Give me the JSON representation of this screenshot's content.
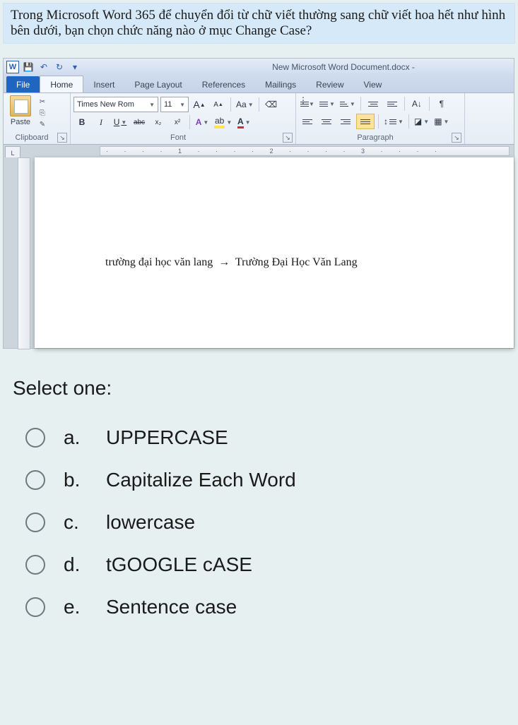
{
  "question": {
    "text": "Trong Microsoft Word 365 để chuyển đổi từ chữ viết thường sang chữ viết hoa hết như hình bên dưới, bạn chọn chức năng nào ở mục Change Case?"
  },
  "word_app": {
    "title": "New Microsoft Word Document.docx -",
    "qat": {
      "w": "W",
      "save": "💾",
      "undo": "↶",
      "redo": "↻",
      "more": "▾"
    },
    "tabs": {
      "file": "File",
      "home": "Home",
      "insert": "Insert",
      "page_layout": "Page Layout",
      "references": "References",
      "mailings": "Mailings",
      "review": "Review",
      "view": "View"
    },
    "clipboard": {
      "paste": "Paste",
      "label": "Clipboard",
      "cut": "✂",
      "copy": "⎘",
      "brush": "✎"
    },
    "font": {
      "name": "Times New Rom",
      "size": "11",
      "grow": "A",
      "shrink": "A",
      "changecase": "Aa",
      "clear": "⌫",
      "bold": "B",
      "italic": "I",
      "underline": "U",
      "strike": "abc",
      "sub": "x₂",
      "sup": "x²",
      "texteffects": "A",
      "highlight": "ab",
      "fontcolor": "A",
      "label": "Font"
    },
    "paragraph": {
      "label": "Paragraph",
      "sort": "A↓",
      "pilcrow": "¶"
    },
    "ruler": {
      "marks": "· · · · 1 · · · · 2 · · · · 3 · · · ·",
      "selector": "L"
    },
    "document": {
      "before": "trường đại học văn lang",
      "arrow": "→",
      "after": "Trường Đại Học Văn Lang"
    }
  },
  "answers": {
    "prompt": "Select one:",
    "options": [
      {
        "letter": "a.",
        "text": "UPPERCASE"
      },
      {
        "letter": "b.",
        "text": "Capitalize Each Word"
      },
      {
        "letter": "c.",
        "text": "lowercase"
      },
      {
        "letter": "d.",
        "text": "tGOOGLE cASE"
      },
      {
        "letter": "e.",
        "text": "Sentence case"
      }
    ]
  }
}
